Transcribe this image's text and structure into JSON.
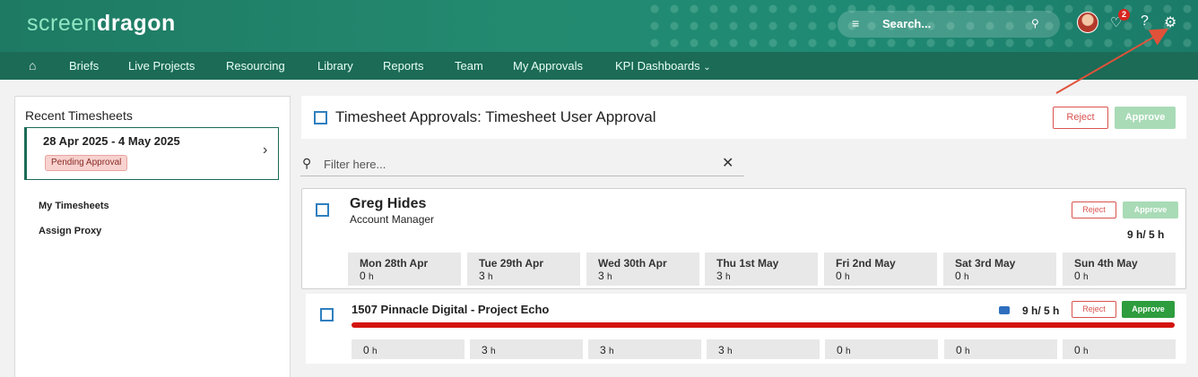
{
  "brand": {
    "part1": "screen",
    "part2": "dragon"
  },
  "topbar": {
    "search_placeholder": "Search...",
    "notifications_count": "2",
    "help": "?"
  },
  "nav": [
    "Briefs",
    "Live Projects",
    "Resourcing",
    "Library",
    "Reports",
    "Team",
    "My Approvals",
    "KPI Dashboards"
  ],
  "left": {
    "title": "Recent Timesheets",
    "range": "28 Apr 2025 - 4 May 2025",
    "status": "Pending Approval",
    "links": [
      "My Timesheets",
      "Assign Proxy"
    ]
  },
  "header": {
    "title": "Timesheet Approvals: Timesheet User Approval",
    "reject": "Reject",
    "approve": "Approve"
  },
  "filter": {
    "placeholder": "Filter here..."
  },
  "user": {
    "name": "Greg Hides",
    "role": "Account Manager",
    "total": "9 h/ 5 h",
    "reject": "Reject",
    "approve": "Approve",
    "days": [
      {
        "label": "Mon 28th Apr",
        "hours": "0"
      },
      {
        "label": "Tue 29th Apr",
        "hours": "3"
      },
      {
        "label": "Wed 30th Apr",
        "hours": "3"
      },
      {
        "label": "Thu 1st May",
        "hours": "3"
      },
      {
        "label": "Fri 2nd May",
        "hours": "0"
      },
      {
        "label": "Sat 3rd May",
        "hours": "0"
      },
      {
        "label": "Sun 4th May",
        "hours": "0"
      }
    ],
    "hour_unit": "h"
  },
  "project": {
    "name": "1507 Pinnacle Digital - Project Echo",
    "total": "9 h/ 5 h",
    "reject": "Reject",
    "approve": "Approve",
    "hours": [
      "0",
      "3",
      "3",
      "3",
      "0",
      "0",
      "0"
    ],
    "hour_unit": "h"
  },
  "icons": [
    "home-icon",
    "menu-icon",
    "search-icon",
    "bell-icon",
    "help-icon",
    "gear-icon",
    "chevron-right-icon",
    "close-icon",
    "budget-icon"
  ],
  "colors": {
    "brand": "#1f8a74",
    "nav": "#1b6b56",
    "reject": "#d9534f",
    "approve": "#2e9d3e",
    "overbar": "#d4140f",
    "arrow": "#e0523a"
  }
}
